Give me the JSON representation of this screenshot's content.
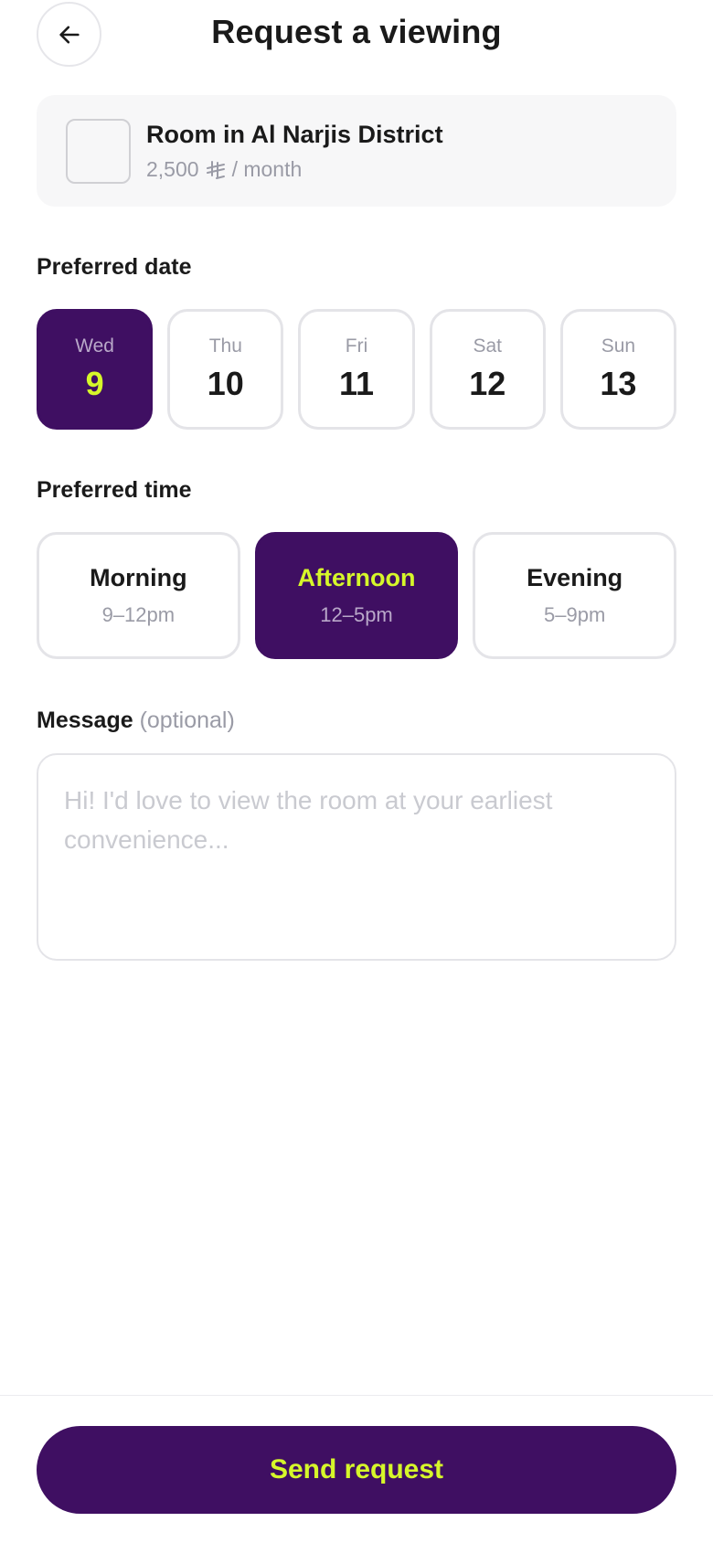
{
  "header": {
    "title": "Request a viewing",
    "back_icon": "arrow-left-icon"
  },
  "listing": {
    "title": "Room in Al Narjis District",
    "price": "2,500",
    "currency_icon": "saudi-riyal-icon",
    "period": "/ month"
  },
  "date_section": {
    "label": "Preferred date",
    "selected_index": 0,
    "dates": [
      {
        "dow": "Wed",
        "day": "9"
      },
      {
        "dow": "Thu",
        "day": "10"
      },
      {
        "dow": "Fri",
        "day": "11"
      },
      {
        "dow": "Sat",
        "day": "12"
      },
      {
        "dow": "Sun",
        "day": "13"
      }
    ]
  },
  "time_section": {
    "label": "Preferred time",
    "selected_index": 1,
    "slots": [
      {
        "label": "Morning",
        "range": "9–12pm"
      },
      {
        "label": "Afternoon",
        "range": "12–5pm"
      },
      {
        "label": "Evening",
        "range": "5–9pm"
      }
    ]
  },
  "message_section": {
    "label": "Message",
    "optional": "(optional)",
    "placeholder": "Hi! I'd love to view the room at your earliest convenience...",
    "value": ""
  },
  "footer": {
    "send_label": "Send request"
  },
  "colors": {
    "brand": "#3f0f62",
    "accent": "#d6f72a",
    "muted": "#9a9ba6"
  }
}
